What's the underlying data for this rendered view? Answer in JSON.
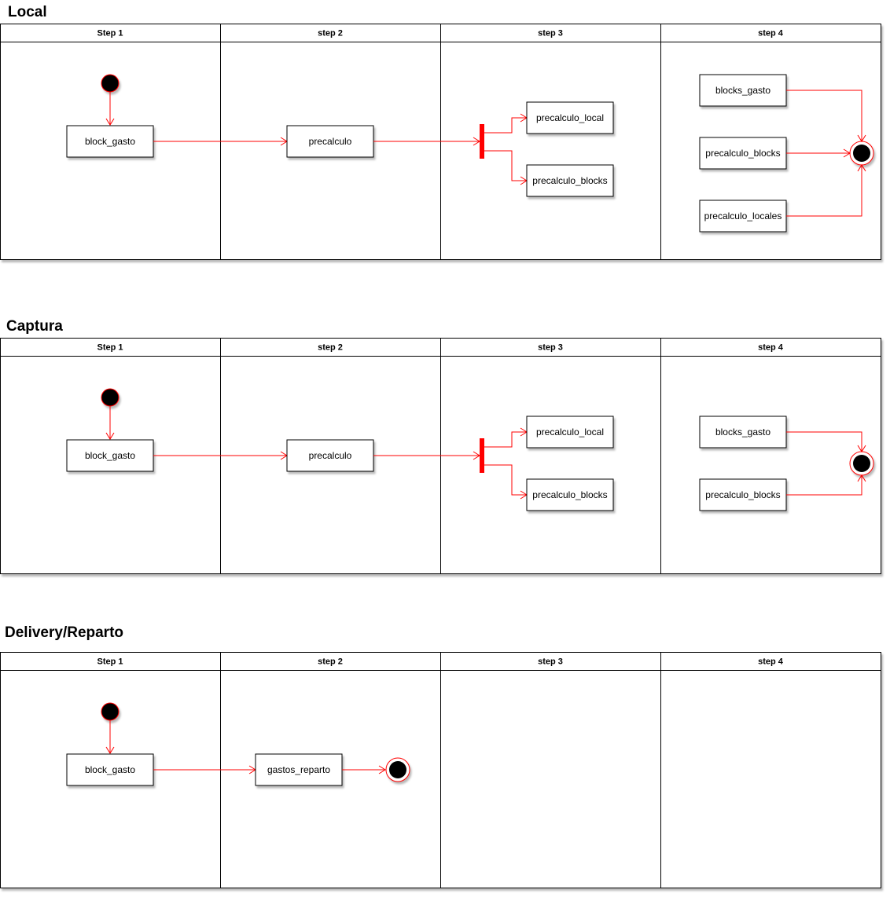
{
  "diagrams": [
    {
      "title": "Local",
      "lanes": [
        "Step 1",
        "step 2",
        "step  3",
        "step  4"
      ],
      "nodes": {
        "block_gasto": "block_gasto",
        "precalculo": "precalculo",
        "precalculo_local": "precalculo_local",
        "precalculo_blocks": "precalculo_blocks",
        "s4_blocks_gasto": "blocks_gasto",
        "s4_precalculo_blocks": "precalculo_blocks",
        "s4_precalculo_locales": "precalculo_locales"
      }
    },
    {
      "title": "Captura",
      "lanes": [
        "Step 1",
        "step 2",
        "step  3",
        "step  4"
      ],
      "nodes": {
        "block_gasto": "block_gasto",
        "precalculo": "precalculo",
        "precalculo_local": "precalculo_local",
        "precalculo_blocks": "precalculo_blocks",
        "s4_blocks_gasto": "blocks_gasto",
        "s4_precalculo_blocks": "precalculo_blocks"
      }
    },
    {
      "title": "Delivery/Reparto",
      "lanes": [
        "Step 1",
        "step 2",
        "step  3",
        "step  4"
      ],
      "nodes": {
        "block_gasto": "block_gasto",
        "gastos_reparto": "gastos_reparto"
      }
    }
  ],
  "colors": {
    "flow": "#ff0000",
    "border": "#000000",
    "node_fill": "#ffffff"
  }
}
